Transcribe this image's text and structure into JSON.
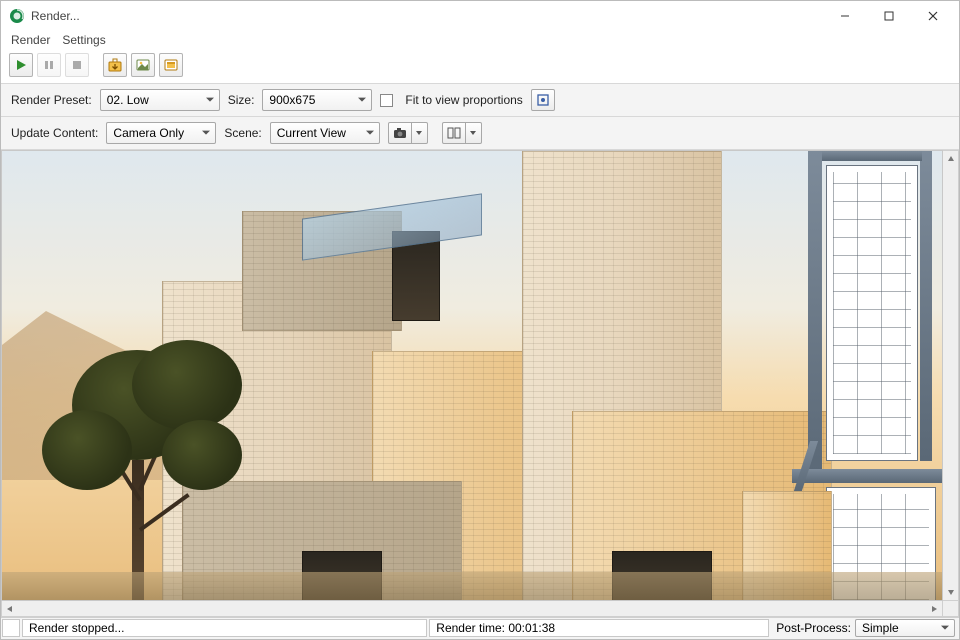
{
  "window": {
    "title": "Render...",
    "app_icon": "thea-render-icon"
  },
  "menu": {
    "render": "Render",
    "settings": "Settings"
  },
  "toolbar": {
    "play": "play-icon",
    "pause": "pause-icon",
    "stop": "stop-icon",
    "save_image": "save-image-icon",
    "save_ldr": "save-ldr-icon",
    "save_hdr": "save-hdr-icon"
  },
  "row1": {
    "render_preset_label": "Render Preset:",
    "render_preset_value": "02. Low",
    "size_label": "Size:",
    "size_value": "900x675",
    "fit_label": "Fit to view proportions",
    "fit_checked": false,
    "pick_size_icon": "crop-icon"
  },
  "row2": {
    "update_content_label": "Update Content:",
    "update_content_value": "Camera Only",
    "scene_label": "Scene:",
    "scene_value": "Current View",
    "camera_icon": "camera-icon",
    "link_icon": "compare-icon"
  },
  "status": {
    "left": "Render stopped...",
    "time": "Render time: 00:01:38",
    "post_label": "Post-Process:",
    "post_value": "Simple"
  },
  "colors": {
    "accent_green": "#2f8f2f",
    "steel": "#6a7886"
  }
}
